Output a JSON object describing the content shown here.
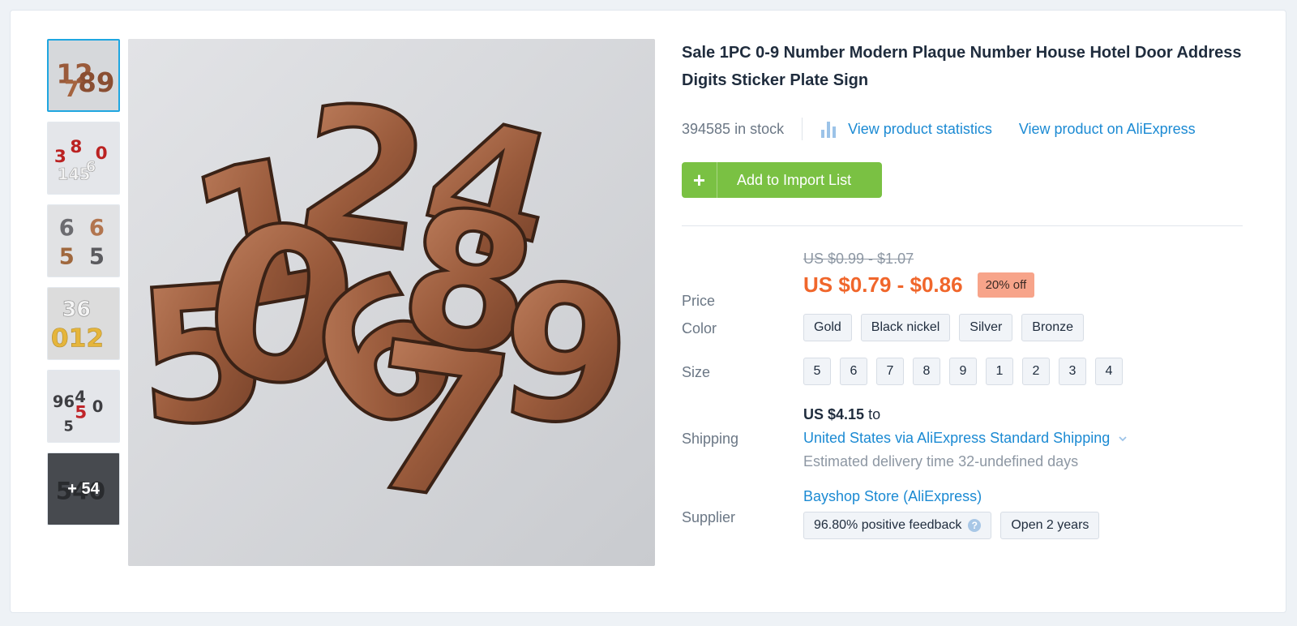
{
  "product": {
    "title": "Sale 1PC 0-9 Number Modern Plaque Number House Hotel Door Address Digits Sticker Plate Sign",
    "stock": "394585 in stock",
    "stats_link": "View product statistics",
    "aliexpress_link": "View product on AliExpress",
    "add_button": "Add to Import List",
    "add_icon": "+",
    "thumbs_more": "+ 54"
  },
  "price": {
    "label": "Price",
    "original": "US $0.99 - $1.07",
    "current": "US $0.79 - $0.86",
    "discount": "20% off"
  },
  "color": {
    "label": "Color",
    "options": [
      "Gold",
      "Black nickel",
      "Silver",
      "Bronze"
    ]
  },
  "size": {
    "label": "Size",
    "options": [
      "5",
      "6",
      "7",
      "8",
      "9",
      "1",
      "2",
      "3",
      "4"
    ]
  },
  "shipping": {
    "label": "Shipping",
    "price": "US $4.15",
    "to": "to",
    "method": "United States via AliExpress Standard Shipping",
    "estimate": "Estimated delivery time 32-undefined days"
  },
  "supplier": {
    "label": "Supplier",
    "name": "Bayshop Store (AliExpress)",
    "feedback": "96.80% positive feedback",
    "help_icon": "?",
    "open": "Open 2 years"
  },
  "colors": {
    "accent_green": "#7ac143",
    "link_blue": "#1b8ad3",
    "price_orange": "#f0662b",
    "discount_bg": "#f7a48a",
    "thumb_active": "#1fa6e0"
  },
  "icons": {
    "stats": "bar-chart-icon",
    "chevron": "chevron-down-icon",
    "help": "question-circle-icon"
  }
}
